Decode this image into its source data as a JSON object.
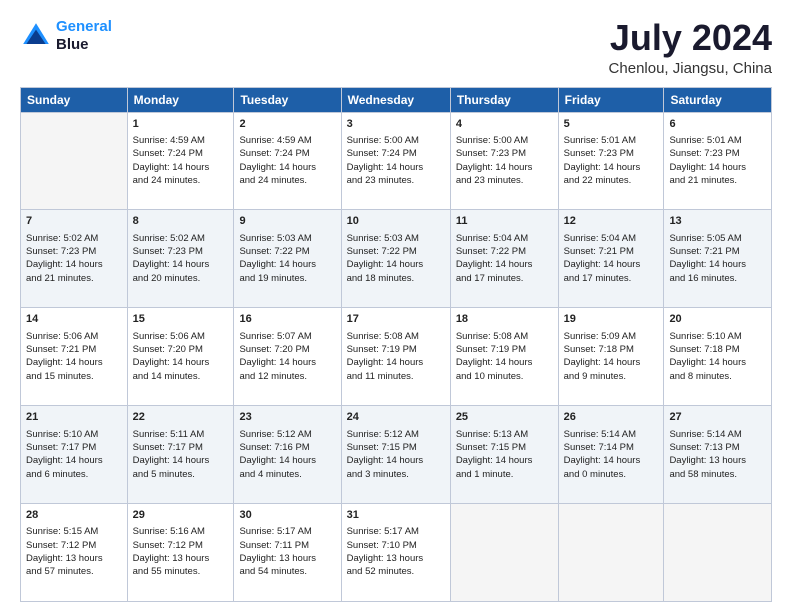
{
  "header": {
    "logo_line1": "General",
    "logo_line2": "Blue",
    "month": "July 2024",
    "location": "Chenlou, Jiangsu, China"
  },
  "weekdays": [
    "Sunday",
    "Monday",
    "Tuesday",
    "Wednesday",
    "Thursday",
    "Friday",
    "Saturday"
  ],
  "weeks": [
    [
      {
        "day": "",
        "info": ""
      },
      {
        "day": "1",
        "info": "Sunrise: 4:59 AM\nSunset: 7:24 PM\nDaylight: 14 hours\nand 24 minutes."
      },
      {
        "day": "2",
        "info": "Sunrise: 4:59 AM\nSunset: 7:24 PM\nDaylight: 14 hours\nand 24 minutes."
      },
      {
        "day": "3",
        "info": "Sunrise: 5:00 AM\nSunset: 7:24 PM\nDaylight: 14 hours\nand 23 minutes."
      },
      {
        "day": "4",
        "info": "Sunrise: 5:00 AM\nSunset: 7:23 PM\nDaylight: 14 hours\nand 23 minutes."
      },
      {
        "day": "5",
        "info": "Sunrise: 5:01 AM\nSunset: 7:23 PM\nDaylight: 14 hours\nand 22 minutes."
      },
      {
        "day": "6",
        "info": "Sunrise: 5:01 AM\nSunset: 7:23 PM\nDaylight: 14 hours\nand 21 minutes."
      }
    ],
    [
      {
        "day": "7",
        "info": "Sunrise: 5:02 AM\nSunset: 7:23 PM\nDaylight: 14 hours\nand 21 minutes."
      },
      {
        "day": "8",
        "info": "Sunrise: 5:02 AM\nSunset: 7:23 PM\nDaylight: 14 hours\nand 20 minutes."
      },
      {
        "day": "9",
        "info": "Sunrise: 5:03 AM\nSunset: 7:22 PM\nDaylight: 14 hours\nand 19 minutes."
      },
      {
        "day": "10",
        "info": "Sunrise: 5:03 AM\nSunset: 7:22 PM\nDaylight: 14 hours\nand 18 minutes."
      },
      {
        "day": "11",
        "info": "Sunrise: 5:04 AM\nSunset: 7:22 PM\nDaylight: 14 hours\nand 17 minutes."
      },
      {
        "day": "12",
        "info": "Sunrise: 5:04 AM\nSunset: 7:21 PM\nDaylight: 14 hours\nand 17 minutes."
      },
      {
        "day": "13",
        "info": "Sunrise: 5:05 AM\nSunset: 7:21 PM\nDaylight: 14 hours\nand 16 minutes."
      }
    ],
    [
      {
        "day": "14",
        "info": "Sunrise: 5:06 AM\nSunset: 7:21 PM\nDaylight: 14 hours\nand 15 minutes."
      },
      {
        "day": "15",
        "info": "Sunrise: 5:06 AM\nSunset: 7:20 PM\nDaylight: 14 hours\nand 14 minutes."
      },
      {
        "day": "16",
        "info": "Sunrise: 5:07 AM\nSunset: 7:20 PM\nDaylight: 14 hours\nand 12 minutes."
      },
      {
        "day": "17",
        "info": "Sunrise: 5:08 AM\nSunset: 7:19 PM\nDaylight: 14 hours\nand 11 minutes."
      },
      {
        "day": "18",
        "info": "Sunrise: 5:08 AM\nSunset: 7:19 PM\nDaylight: 14 hours\nand 10 minutes."
      },
      {
        "day": "19",
        "info": "Sunrise: 5:09 AM\nSunset: 7:18 PM\nDaylight: 14 hours\nand 9 minutes."
      },
      {
        "day": "20",
        "info": "Sunrise: 5:10 AM\nSunset: 7:18 PM\nDaylight: 14 hours\nand 8 minutes."
      }
    ],
    [
      {
        "day": "21",
        "info": "Sunrise: 5:10 AM\nSunset: 7:17 PM\nDaylight: 14 hours\nand 6 minutes."
      },
      {
        "day": "22",
        "info": "Sunrise: 5:11 AM\nSunset: 7:17 PM\nDaylight: 14 hours\nand 5 minutes."
      },
      {
        "day": "23",
        "info": "Sunrise: 5:12 AM\nSunset: 7:16 PM\nDaylight: 14 hours\nand 4 minutes."
      },
      {
        "day": "24",
        "info": "Sunrise: 5:12 AM\nSunset: 7:15 PM\nDaylight: 14 hours\nand 3 minutes."
      },
      {
        "day": "25",
        "info": "Sunrise: 5:13 AM\nSunset: 7:15 PM\nDaylight: 14 hours\nand 1 minute."
      },
      {
        "day": "26",
        "info": "Sunrise: 5:14 AM\nSunset: 7:14 PM\nDaylight: 14 hours\nand 0 minutes."
      },
      {
        "day": "27",
        "info": "Sunrise: 5:14 AM\nSunset: 7:13 PM\nDaylight: 13 hours\nand 58 minutes."
      }
    ],
    [
      {
        "day": "28",
        "info": "Sunrise: 5:15 AM\nSunset: 7:12 PM\nDaylight: 13 hours\nand 57 minutes."
      },
      {
        "day": "29",
        "info": "Sunrise: 5:16 AM\nSunset: 7:12 PM\nDaylight: 13 hours\nand 55 minutes."
      },
      {
        "day": "30",
        "info": "Sunrise: 5:17 AM\nSunset: 7:11 PM\nDaylight: 13 hours\nand 54 minutes."
      },
      {
        "day": "31",
        "info": "Sunrise: 5:17 AM\nSunset: 7:10 PM\nDaylight: 13 hours\nand 52 minutes."
      },
      {
        "day": "",
        "info": ""
      },
      {
        "day": "",
        "info": ""
      },
      {
        "day": "",
        "info": ""
      }
    ]
  ]
}
